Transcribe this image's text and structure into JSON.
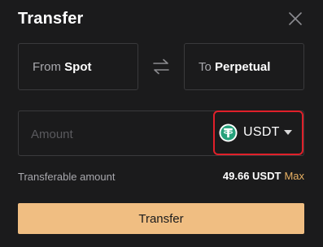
{
  "dialog": {
    "title": "Transfer",
    "close_icon": "close-icon"
  },
  "from": {
    "prefix": "From",
    "account": "Spot"
  },
  "swap_icon": "swap-arrows-icon",
  "to": {
    "prefix": "To",
    "account": "Perpetual"
  },
  "amount": {
    "placeholder": "Amount",
    "value": ""
  },
  "coin": {
    "symbol": "USDT",
    "icon": "tether-icon",
    "icon_color": "#26a17b",
    "dropdown_icon": "caret-down-icon",
    "highlight_color": "#e0202a"
  },
  "transferable": {
    "label": "Transferable amount",
    "value": "49.66 USDT",
    "max_label": "Max"
  },
  "submit": {
    "label": "Transfer",
    "color": "#f0be82"
  },
  "colors": {
    "background": "#1b1b1c",
    "accent": "#e9b163"
  }
}
